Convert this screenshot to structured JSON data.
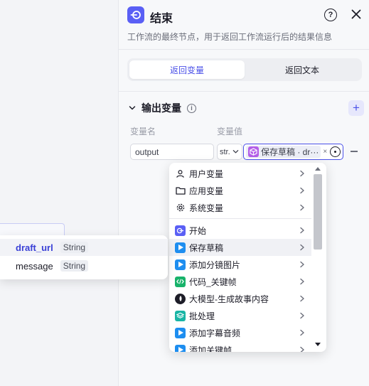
{
  "header": {
    "title": "结束",
    "description": "工作流的最终节点，用于返回工作流运行后的结果信息"
  },
  "tabs": [
    {
      "label": "返回变量",
      "active": true
    },
    {
      "label": "返回文本",
      "active": false
    }
  ],
  "output_section": {
    "title": "输出变量",
    "col_name": "变量名",
    "col_value": "变量值",
    "row": {
      "name": "output",
      "type": "str.",
      "ref_label": "保存草稿 · dr···",
      "tag_close": "×"
    }
  },
  "dropdown": {
    "items": [
      {
        "label": "用户变量",
        "icon": "user-icon",
        "color": "#1d1d28"
      },
      {
        "label": "应用变量",
        "icon": "folder-icon",
        "color": "#1d1d28"
      },
      {
        "label": "系统变量",
        "icon": "gear-icon",
        "color": "#1d1d28"
      },
      {
        "label": "开始",
        "icon": "start-node-icon",
        "color": "#5a5ff5"
      },
      {
        "label": "保存草稿",
        "icon": "plugin-node-icon",
        "color": "#1e8ef0",
        "hover": true
      },
      {
        "label": "添加分镜图片",
        "icon": "plugin-node-icon",
        "color": "#1e8ef0"
      },
      {
        "label": "代码_关键帧",
        "icon": "code-node-icon",
        "color": "#17b26a"
      },
      {
        "label": "大模型-生成故事内容",
        "icon": "llm-node-icon",
        "color": "#1d1d28"
      },
      {
        "label": "批处理",
        "icon": "batch-node-icon",
        "color": "#19b5a5"
      },
      {
        "label": "添加字幕音频",
        "icon": "plugin-node-icon",
        "color": "#1e8ef0"
      },
      {
        "label": "添加关键帧",
        "icon": "plugin-node-icon",
        "color": "#1e8ef0"
      }
    ]
  },
  "submenu": {
    "items": [
      {
        "name": "draft_url",
        "type": "String"
      },
      {
        "name": "message",
        "type": "String"
      }
    ]
  }
}
